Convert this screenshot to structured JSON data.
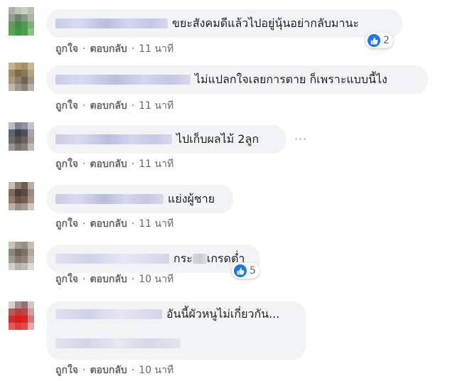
{
  "comments": [
    {
      "text": "ขยะสังคมดีแล้วไปอยู่นุ้นอย่ากลับมานะ",
      "reactions": "2",
      "like_label": "ถูกใจ",
      "reply_label": "ตอบกลับ",
      "time": "11 นาที"
    },
    {
      "text": "ไม่แปลกใจเลยการตาย ก็เพราะแบบนี้ไง",
      "like_label": "ถูกใจ",
      "reply_label": "ตอบกลับ",
      "time": "11 นาที"
    },
    {
      "text": "ไปเก็บผลไม้ 2ลูก",
      "like_label": "ถูกใจ",
      "reply_label": "ตอบกลับ",
      "time": "11 นาที",
      "more_icon": "···"
    },
    {
      "text": "แย่งผู้ชาย",
      "like_label": "ถูกใจ",
      "reply_label": "ตอบกลับ",
      "time": "11 นาที"
    },
    {
      "text_before": "กระ",
      "text_after": "เกรดต่ำ",
      "reactions": "5",
      "like_label": "ถูกใจ",
      "reply_label": "ตอบกลับ",
      "time": "10 นาที"
    },
    {
      "text": "อันนี้ผัวหนูไม่เกี่ยวกัน...",
      "like_label": "ถูกใจ",
      "reply_label": "ตอบกลับ",
      "time": "10 นาที"
    }
  ],
  "colors": {
    "bubble": "#f2f3f5",
    "action_text": "#65676b",
    "like_blue": "#1877f2"
  },
  "icons": {
    "reaction": "like-icon",
    "more": "more-options-icon",
    "avatar": "pixelated-avatar"
  }
}
